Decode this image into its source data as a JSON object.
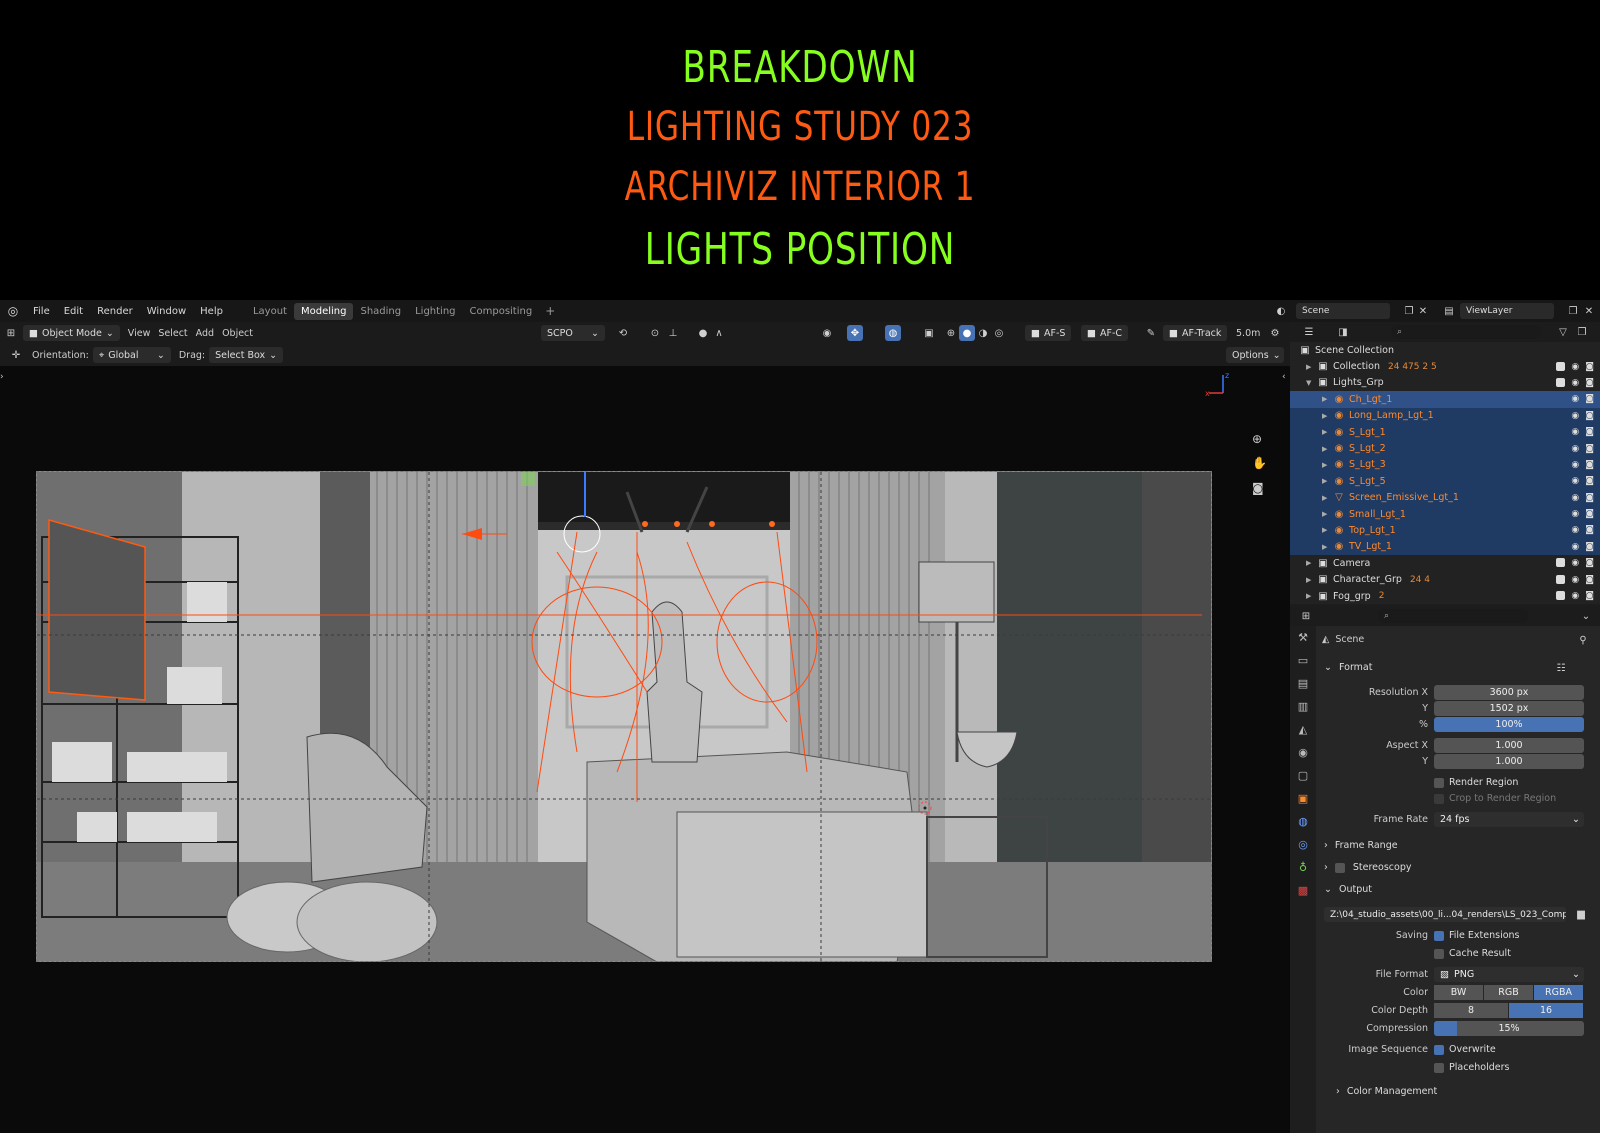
{
  "titles": {
    "line1": "BREAKDOWN",
    "line2": "LIGHTING  STUDY  023",
    "line3": "ARCHIVIZ INTERIOR 1",
    "line4": "LIGHTS POSITION"
  },
  "menu": [
    "File",
    "Edit",
    "Render",
    "Window",
    "Help"
  ],
  "workspaces": [
    {
      "label": "Layout",
      "active": false
    },
    {
      "label": "Modeling",
      "active": true
    },
    {
      "label": "Shading",
      "active": false
    },
    {
      "label": "Lighting",
      "active": false
    },
    {
      "label": "Compositing",
      "active": false
    }
  ],
  "scene_name": "Scene",
  "view_layer": "ViewLayer",
  "viewport_header": {
    "mode": "Object Mode",
    "menus": [
      "View",
      "Select",
      "Add",
      "Object"
    ],
    "transform_orientation": "SCPO",
    "af_s": "AF-S",
    "af_c": "AF-C",
    "af_track": "AF-Track",
    "distance": "5.0m"
  },
  "tool_options": {
    "orientation_label": "Orientation:",
    "orientation_value": "Global",
    "drag_label": "Drag:",
    "drag_value": "Select Box",
    "options_label": "Options"
  },
  "outliner": {
    "root": "Scene Collection",
    "rows": [
      {
        "name": "Collection",
        "kind": "collection",
        "indent": 1,
        "extra": "24 475 2 5",
        "selected": false
      },
      {
        "name": "Lights_Grp",
        "kind": "collection",
        "indent": 1,
        "extra": "",
        "selected": false
      },
      {
        "name": "Ch_Lgt_1",
        "kind": "light",
        "indent": 2,
        "extra": "",
        "selected": "active"
      },
      {
        "name": "Long_Lamp_Lgt_1",
        "kind": "light",
        "indent": 2,
        "extra": "",
        "selected": true
      },
      {
        "name": "S_Lgt_1",
        "kind": "light",
        "indent": 2,
        "extra": "",
        "selected": true
      },
      {
        "name": "S_Lgt_2",
        "kind": "light",
        "indent": 2,
        "extra": "",
        "selected": true
      },
      {
        "name": "S_Lgt_3",
        "kind": "light",
        "indent": 2,
        "extra": "",
        "selected": true
      },
      {
        "name": "S_Lgt_5",
        "kind": "light",
        "indent": 2,
        "extra": "",
        "selected": true
      },
      {
        "name": "Screen_Emissive_Lgt_1",
        "kind": "mesh",
        "indent": 2,
        "extra": "",
        "selected": true
      },
      {
        "name": "Small_Lgt_1",
        "kind": "light",
        "indent": 2,
        "extra": "",
        "selected": true
      },
      {
        "name": "Top_Lgt_1",
        "kind": "light",
        "indent": 2,
        "extra": "",
        "selected": true
      },
      {
        "name": "TV_Lgt_1",
        "kind": "light",
        "indent": 2,
        "extra": "",
        "selected": true
      },
      {
        "name": "Camera",
        "kind": "collection",
        "indent": 1,
        "extra": "",
        "selected": false
      },
      {
        "name": "Character_Grp",
        "kind": "collection",
        "indent": 1,
        "extra": "24 4",
        "selected": false
      },
      {
        "name": "Fog_grp",
        "kind": "collection",
        "indent": 1,
        "extra": "2",
        "selected": false
      }
    ]
  },
  "properties": {
    "context": "Scene",
    "format_header": "Format",
    "resolution_x_label": "Resolution X",
    "resolution_x": "3600 px",
    "resolution_y_label": "Y",
    "resolution_y": "1502 px",
    "percent_label": "%",
    "percent": "100%",
    "aspect_x_label": "Aspect X",
    "aspect_x": "1.000",
    "aspect_y_label": "Y",
    "aspect_y": "1.000",
    "render_region": "Render Region",
    "crop_region": "Crop to Render Region",
    "frame_rate_label": "Frame Rate",
    "frame_rate": "24 fps",
    "frame_range_header": "Frame Range",
    "stereoscopy_header": "Stereoscopy",
    "output_header": "Output",
    "output_path": "Z:\\04_studio_assets\\00_li...04_renders\\LS_023_Comp",
    "saving_label": "Saving",
    "file_extensions": "File Extensions",
    "cache_result": "Cache Result",
    "file_format_label": "File Format",
    "file_format": "PNG",
    "color_label": "Color",
    "color_options": [
      "BW",
      "RGB",
      "RGBA"
    ],
    "color_selected": "RGBA",
    "color_depth_label": "Color Depth",
    "color_depth_options": [
      "8",
      "16"
    ],
    "color_depth_selected": "16",
    "compression_label": "Compression",
    "compression": "15%",
    "compression_fraction": 0.15,
    "image_sequence_label": "Image Sequence",
    "overwrite": "Overwrite",
    "placeholders": "Placeholders",
    "color_management_header": "Color Management"
  },
  "colors": {
    "title_green": "#86ff1e",
    "title_orange": "#ff5a12",
    "light_name": "#ff8a2a",
    "selection_blue": "#4772b3",
    "outliner_selected": "#1f3a63"
  }
}
